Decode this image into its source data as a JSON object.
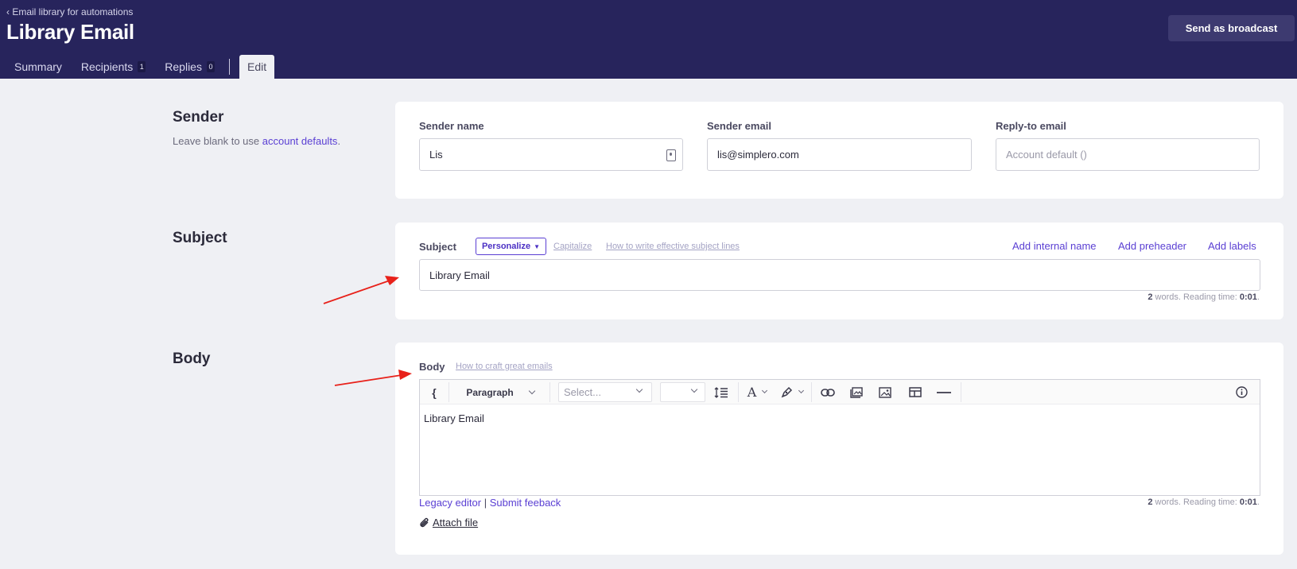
{
  "header": {
    "breadcrumb": "‹ Email library for automations",
    "title": "Library Email",
    "broadcast_button": "Send as broadcast"
  },
  "tabs": [
    {
      "label": "Summary"
    },
    {
      "label": "Recipients",
      "count": "1"
    },
    {
      "label": "Replies",
      "count": "0"
    },
    {
      "label": "Edit",
      "active": true
    }
  ],
  "sender": {
    "section_title": "Sender",
    "desc_prefix": "Leave blank to use ",
    "desc_link": "account defaults",
    "desc_suffix": ".",
    "name_label": "Sender name",
    "name_value": "Lis",
    "email_label": "Sender email",
    "email_value": "lis@simplero.com",
    "reply_label": "Reply-to email",
    "reply_placeholder": "Account default ()"
  },
  "subject": {
    "section_title": "Subject",
    "label": "Subject",
    "personalize": "Personalize",
    "capitalize": "Capitalize",
    "howto": "How to write effective subject lines",
    "add_internal_name": "Add internal name",
    "add_preheader": "Add preheader",
    "add_labels": "Add labels",
    "value": "Library Email",
    "stats_words": "2",
    "stats_mid": " words. Reading time: ",
    "stats_time": "0:01",
    "stats_end": "."
  },
  "body": {
    "section_title": "Body",
    "label": "Body",
    "howto": "How to craft great emails",
    "toolbar": {
      "block_format": "Paragraph",
      "font_select_placeholder": "Select...",
      "brace": "{"
    },
    "content": "Library Email",
    "legacy_editor": "Legacy editor",
    "separator": "|",
    "submit_feedback": "Submit feeback",
    "stats_words": "2",
    "stats_mid": " words. Reading time: ",
    "stats_time": "0:01",
    "stats_end": ".",
    "attach_file": "Attach file"
  },
  "colors": {
    "header_bg": "#27245c",
    "accent": "#5a3fd3",
    "annotation_arrow": "#e8211a",
    "page_bg": "#eff0f4"
  }
}
